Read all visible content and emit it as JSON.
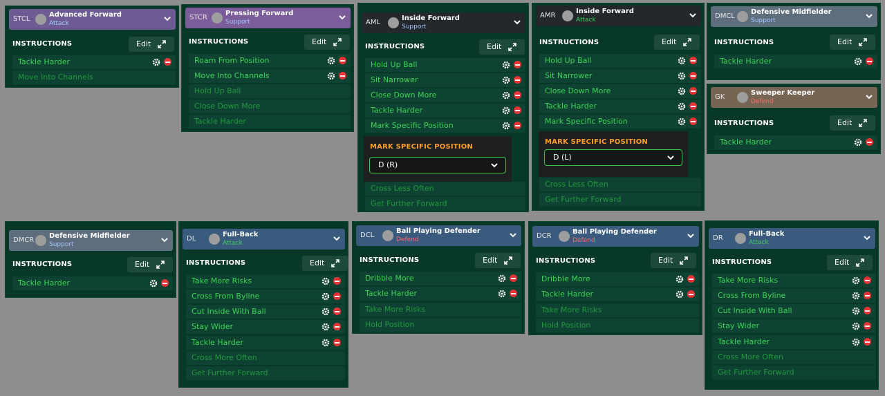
{
  "panels": [
    {
      "pos": "STCL",
      "role": "Advanced Forward",
      "duty": "Attack",
      "inst": "INSTRUCTIONS",
      "edit": "Edit",
      "active": [
        "Tackle Harder"
      ],
      "inactive": [
        "Move Into Channels"
      ]
    },
    {
      "pos": "STCR",
      "role": "Pressing Forward",
      "duty": "Support",
      "inst": "INSTRUCTIONS",
      "edit": "Edit",
      "active": [
        "Roam From Position",
        "Move Into Channels"
      ],
      "inactive": [
        "Hold Up Ball",
        "Close Down More",
        "Tackle Harder"
      ]
    },
    {
      "pos": "AML",
      "role": "Inside Forward",
      "duty": "Support",
      "inst": "INSTRUCTIONS",
      "edit": "Edit",
      "active": [
        "Hold Up Ball",
        "Sit Narrower",
        "Close Down More",
        "Tackle Harder",
        "Mark Specific Position"
      ],
      "inactive": [
        "Cross Less Often",
        "Get Further Forward"
      ],
      "popup": {
        "title": "MARK SPECIFIC POSITION",
        "value": "D (R)"
      }
    },
    {
      "pos": "AMR",
      "role": "Inside Forward",
      "duty": "Attack",
      "inst": "INSTRUCTIONS",
      "edit": "Edit",
      "active": [
        "Hold Up Ball",
        "Sit Narrower",
        "Close Down More",
        "Tackle Harder",
        "Mark Specific Position"
      ],
      "inactive": [
        "Cross Less Often",
        "Get Further Forward"
      ],
      "popup": {
        "title": "MARK SPECIFIC POSITION",
        "value": "D (L)"
      }
    },
    {
      "pos": "DMCL",
      "role": "Defensive Midfielder",
      "duty": "Support",
      "inst": "INSTRUCTIONS",
      "edit": "Edit",
      "active": [
        "Tackle Harder"
      ],
      "inactive": []
    },
    {
      "pos": "GK",
      "role": "Sweeper Keeper",
      "duty": "Defend",
      "inst": "INSTRUCTIONS",
      "edit": "Edit",
      "active": [
        "Tackle Harder"
      ],
      "inactive": []
    },
    {
      "pos": "DMCR",
      "role": "Defensive Midfielder",
      "duty": "Support",
      "inst": "INSTRUCTIONS",
      "edit": "Edit",
      "active": [
        "Tackle Harder"
      ],
      "inactive": []
    },
    {
      "pos": "DL",
      "role": "Full-Back",
      "duty": "Attack",
      "inst": "INSTRUCTIONS",
      "edit": "Edit",
      "active": [
        "Take More Risks",
        "Cross From Byline",
        "Cut Inside With Ball",
        "Stay Wider",
        "Tackle Harder"
      ],
      "inactive": [
        "Cross More Often",
        "Get Further Forward"
      ]
    },
    {
      "pos": "DCL",
      "role": "Ball Playing Defender",
      "duty": "Defend",
      "inst": "INSTRUCTIONS",
      "edit": "Edit",
      "active": [
        "Dribble More",
        "Tackle Harder"
      ],
      "inactive": [
        "Take More Risks",
        "Hold Position"
      ]
    },
    {
      "pos": "DCR",
      "role": "Ball Playing Defender",
      "duty": "Defend",
      "inst": "INSTRUCTIONS",
      "edit": "Edit",
      "active": [
        "Dribble More",
        "Tackle Harder"
      ],
      "inactive": [
        "Take More Risks",
        "Hold Position"
      ]
    },
    {
      "pos": "DR",
      "role": "Full-Back",
      "duty": "Attack",
      "inst": "INSTRUCTIONS",
      "edit": "Edit",
      "active": [
        "Take More Risks",
        "Cross From Byline",
        "Cut Inside With Ball",
        "Stay Wider",
        "Tackle Harder"
      ],
      "inactive": [
        "Cross More Often",
        "Get Further Forward"
      ]
    }
  ]
}
